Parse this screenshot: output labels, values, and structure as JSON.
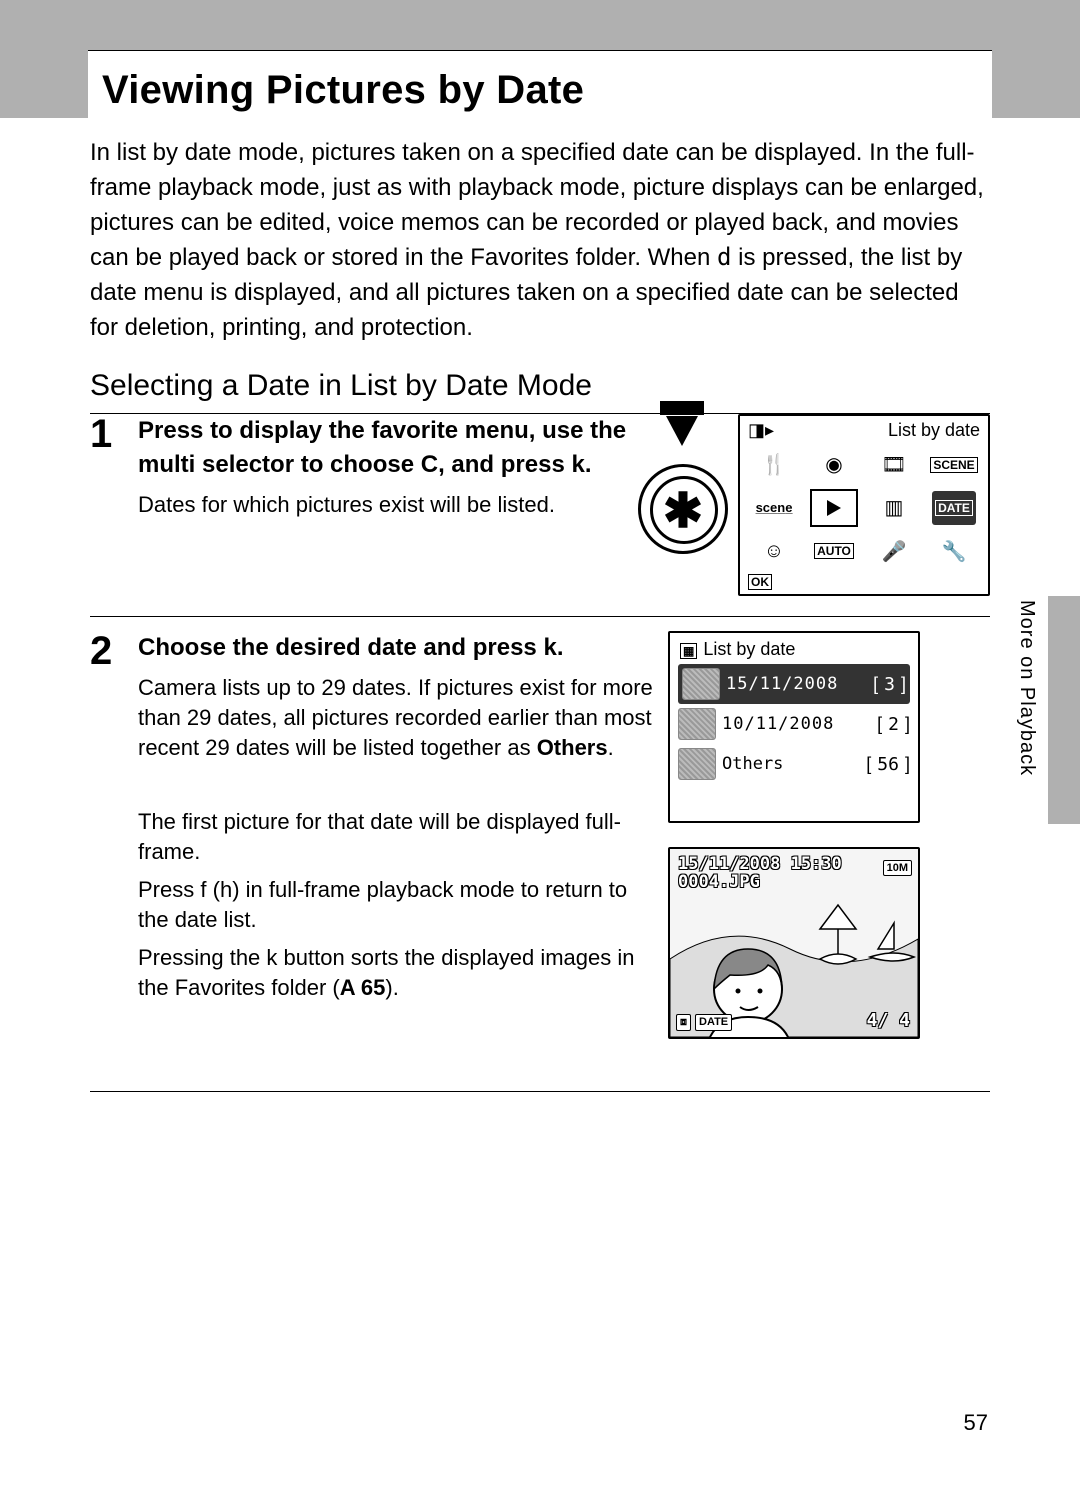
{
  "header": {
    "title": "Viewing Pictures by Date"
  },
  "intro": {
    "text_a": "In list by date mode, pictures taken on a specified date can be displayed. In the full-frame playback mode, just as with playback mode, picture displays can be enlarged, pictures can be edited, voice memos can be recorded or played back, and movies can be played back or stored in the Favorites folder. When ",
    "glyph_menu": "d",
    "text_b": " is pressed, the list by date menu is displayed, and all pictures taken on a specified date can be selected for deletion, printing, and protection."
  },
  "h2": "Selecting a Date in List by Date Mode",
  "step1": {
    "num": "1",
    "title_a": "Press ",
    "title_b": " to display the favorite menu, use the multi selector to choose ",
    "glyph_c": "C",
    "title_c": ", and press ",
    "glyph_ok": "k",
    "title_d": ".",
    "note": "Dates for which pictures exist will be listed.",
    "panel_title_right": "List by date",
    "panel_cam_glyph": "▸",
    "ok_label": "OK"
  },
  "step2": {
    "num": "2",
    "title_a": "Choose the desired date and press ",
    "glyph_ok": "k",
    "title_b": ".",
    "note_a": "Camera lists up to 29 dates. If pictures exist for more than 29 dates, all pictures recorded earlier than most recent 29 dates will be listed together as ",
    "note_bold": "Others",
    "note_b": ".",
    "panel_title": "List by date",
    "rows": [
      {
        "date": "15/11/2008",
        "count": "3"
      },
      {
        "date": "10/11/2008",
        "count": "2"
      },
      {
        "date": "Others",
        "count": "56"
      }
    ],
    "after_a": "The first picture for that date will be displayed full-frame.",
    "after_b_1": "Press ",
    "after_b_glyph_f": "f",
    "after_b_2": " (",
    "after_b_glyph_h": "h",
    "after_b_3": ") in full-frame playback mode to return to the date list.",
    "after_c_1": "Pressing the ",
    "after_c_glyph": "k",
    "after_c_2": " button sorts the displayed images in the Favorites folder (",
    "after_c_ref": "A 65",
    "after_c_3": ").",
    "preview": {
      "timestamp": "15/11/2008 15:30",
      "filename": "0004.JPG",
      "counter": "4/ 4",
      "badge_date": "DATE",
      "badge_res": "10M"
    }
  },
  "side_label": "More on Playback",
  "page_num": "57"
}
